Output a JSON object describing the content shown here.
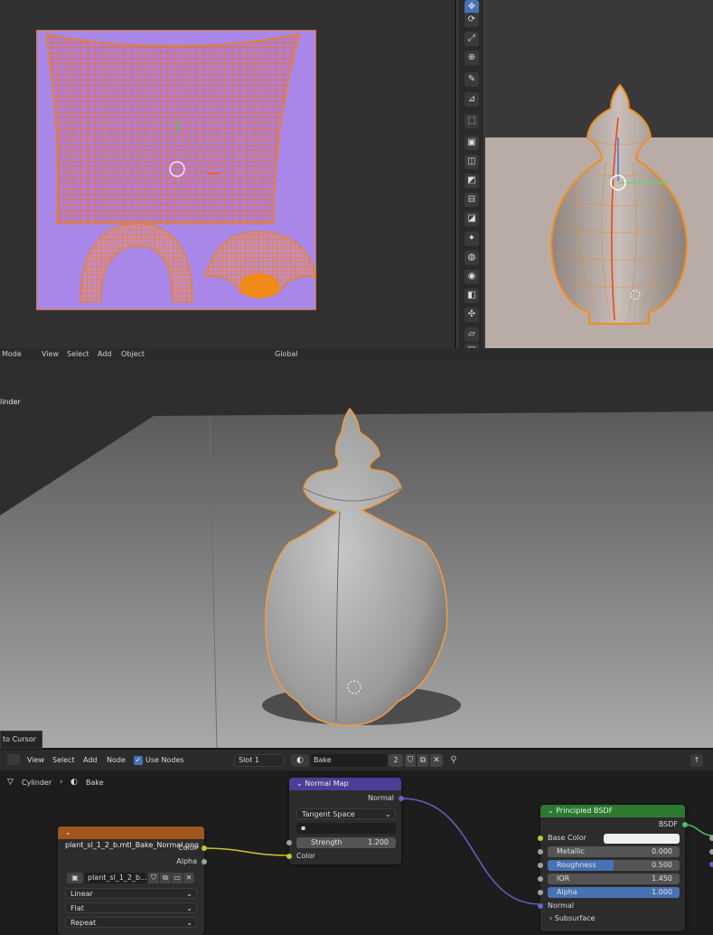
{
  "viewport_header": {
    "items": [
      "Mode",
      "View",
      "Select",
      "Add",
      "Object"
    ],
    "orientation": "Global"
  },
  "viewport": {
    "object_label": "linder",
    "operator_panel": "to Cursor"
  },
  "node_header": {
    "menus": [
      "View",
      "Select",
      "Add",
      "Node"
    ],
    "use_nodes_label": "Use Nodes",
    "slot": "Slot 1",
    "material_name": "Bake",
    "user_count": "2"
  },
  "breadcrumb": {
    "object": "Cylinder",
    "material": "Bake"
  },
  "image_texture_node": {
    "title": "plant_sl_1_2_b.mtl_Bake_Normal.png",
    "out_color": "Color",
    "out_alpha": "Alpha",
    "image_name": "plant_sl_1_2_b....",
    "interpolation": "Linear",
    "projection": "Flat",
    "extension": "Repeat"
  },
  "normal_map_node": {
    "title": "Normal Map",
    "out_normal": "Normal",
    "space": "Tangent Space",
    "uv_map": "",
    "strength_label": "Strength",
    "strength_value": "1.200",
    "in_color": "Color"
  },
  "principled_node": {
    "title": "Principled BSDF",
    "out_bsdf": "BSDF",
    "base_color_label": "Base Color",
    "metallic_label": "Metallic",
    "metallic_value": "0.000",
    "metallic_fill": 0.0,
    "roughness_label": "Roughness",
    "roughness_value": "0.500",
    "roughness_fill": 0.5,
    "ior_label": "IOR",
    "ior_value": "1.450",
    "alpha_label": "Alpha",
    "alpha_value": "1.000",
    "alpha_fill": 1.0,
    "normal_label": "Normal",
    "subsurface_label": "Subsurface"
  },
  "colors": {
    "accent": "#4772b3",
    "selection_orange": "#e8821e",
    "uv_background": "#a987e8",
    "image_node_header": "#a0561c",
    "normal_map_header": "#4a3f96",
    "principled_header": "#2b7a30"
  }
}
